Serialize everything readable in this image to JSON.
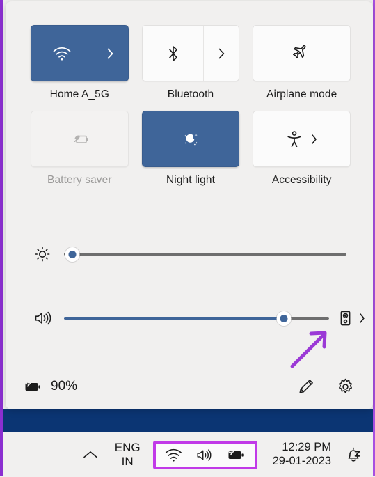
{
  "panel": {
    "tiles": [
      {
        "id": "wifi",
        "label": "Home A_5G",
        "icon": "wifi-icon",
        "state": "on",
        "split": true,
        "chevron": true
      },
      {
        "id": "bluetooth",
        "label": "Bluetooth",
        "icon": "bluetooth-icon",
        "state": "off",
        "split": true,
        "chevron": true
      },
      {
        "id": "airplane",
        "label": "Airplane mode",
        "icon": "airplane-icon",
        "state": "off",
        "split": false,
        "chevron": false
      },
      {
        "id": "battery-saver",
        "label": "Battery saver",
        "icon": "battery-leaf-icon",
        "state": "disabled",
        "split": false,
        "chevron": false
      },
      {
        "id": "night-light",
        "label": "Night light",
        "icon": "moon-icon",
        "state": "on",
        "split": false,
        "chevron": false
      },
      {
        "id": "accessibility",
        "label": "Accessibility",
        "icon": "accessibility-icon",
        "state": "off",
        "split": false,
        "chevron": true
      }
    ],
    "sliders": [
      {
        "id": "brightness",
        "icon": "brightness-icon",
        "value": 3,
        "filled": false
      },
      {
        "id": "volume",
        "icon": "volume-icon",
        "value": 83,
        "filled": true
      }
    ],
    "volume_output": {
      "icon": "speaker-device-icon",
      "chevron": "chevron-right-icon"
    },
    "footer": {
      "battery_icon": "battery-charging-icon",
      "battery_percent": "90%",
      "edit_icon": "pencil-icon",
      "settings_icon": "gear-icon"
    }
  },
  "annotation": {
    "arrow": "arrow-up-right",
    "color": "#9b39d6"
  },
  "taskbar": {
    "overflow_icon": "chevron-up-icon",
    "language": {
      "line1": "ENG",
      "line2": "IN"
    },
    "tray_icons": [
      "wifi-icon",
      "volume-icon",
      "battery-charging-icon"
    ],
    "tray_highlight_color": "#c13ae8",
    "clock": {
      "time": "12:29 PM",
      "date": "29-01-2023"
    },
    "notification_icon": "bell-dnd-icon"
  },
  "colors": {
    "accent": "#3f6599",
    "highlight": "#c13ae8",
    "panel_bg": "#f1f0ef",
    "wallpaper": "#0b3573"
  }
}
